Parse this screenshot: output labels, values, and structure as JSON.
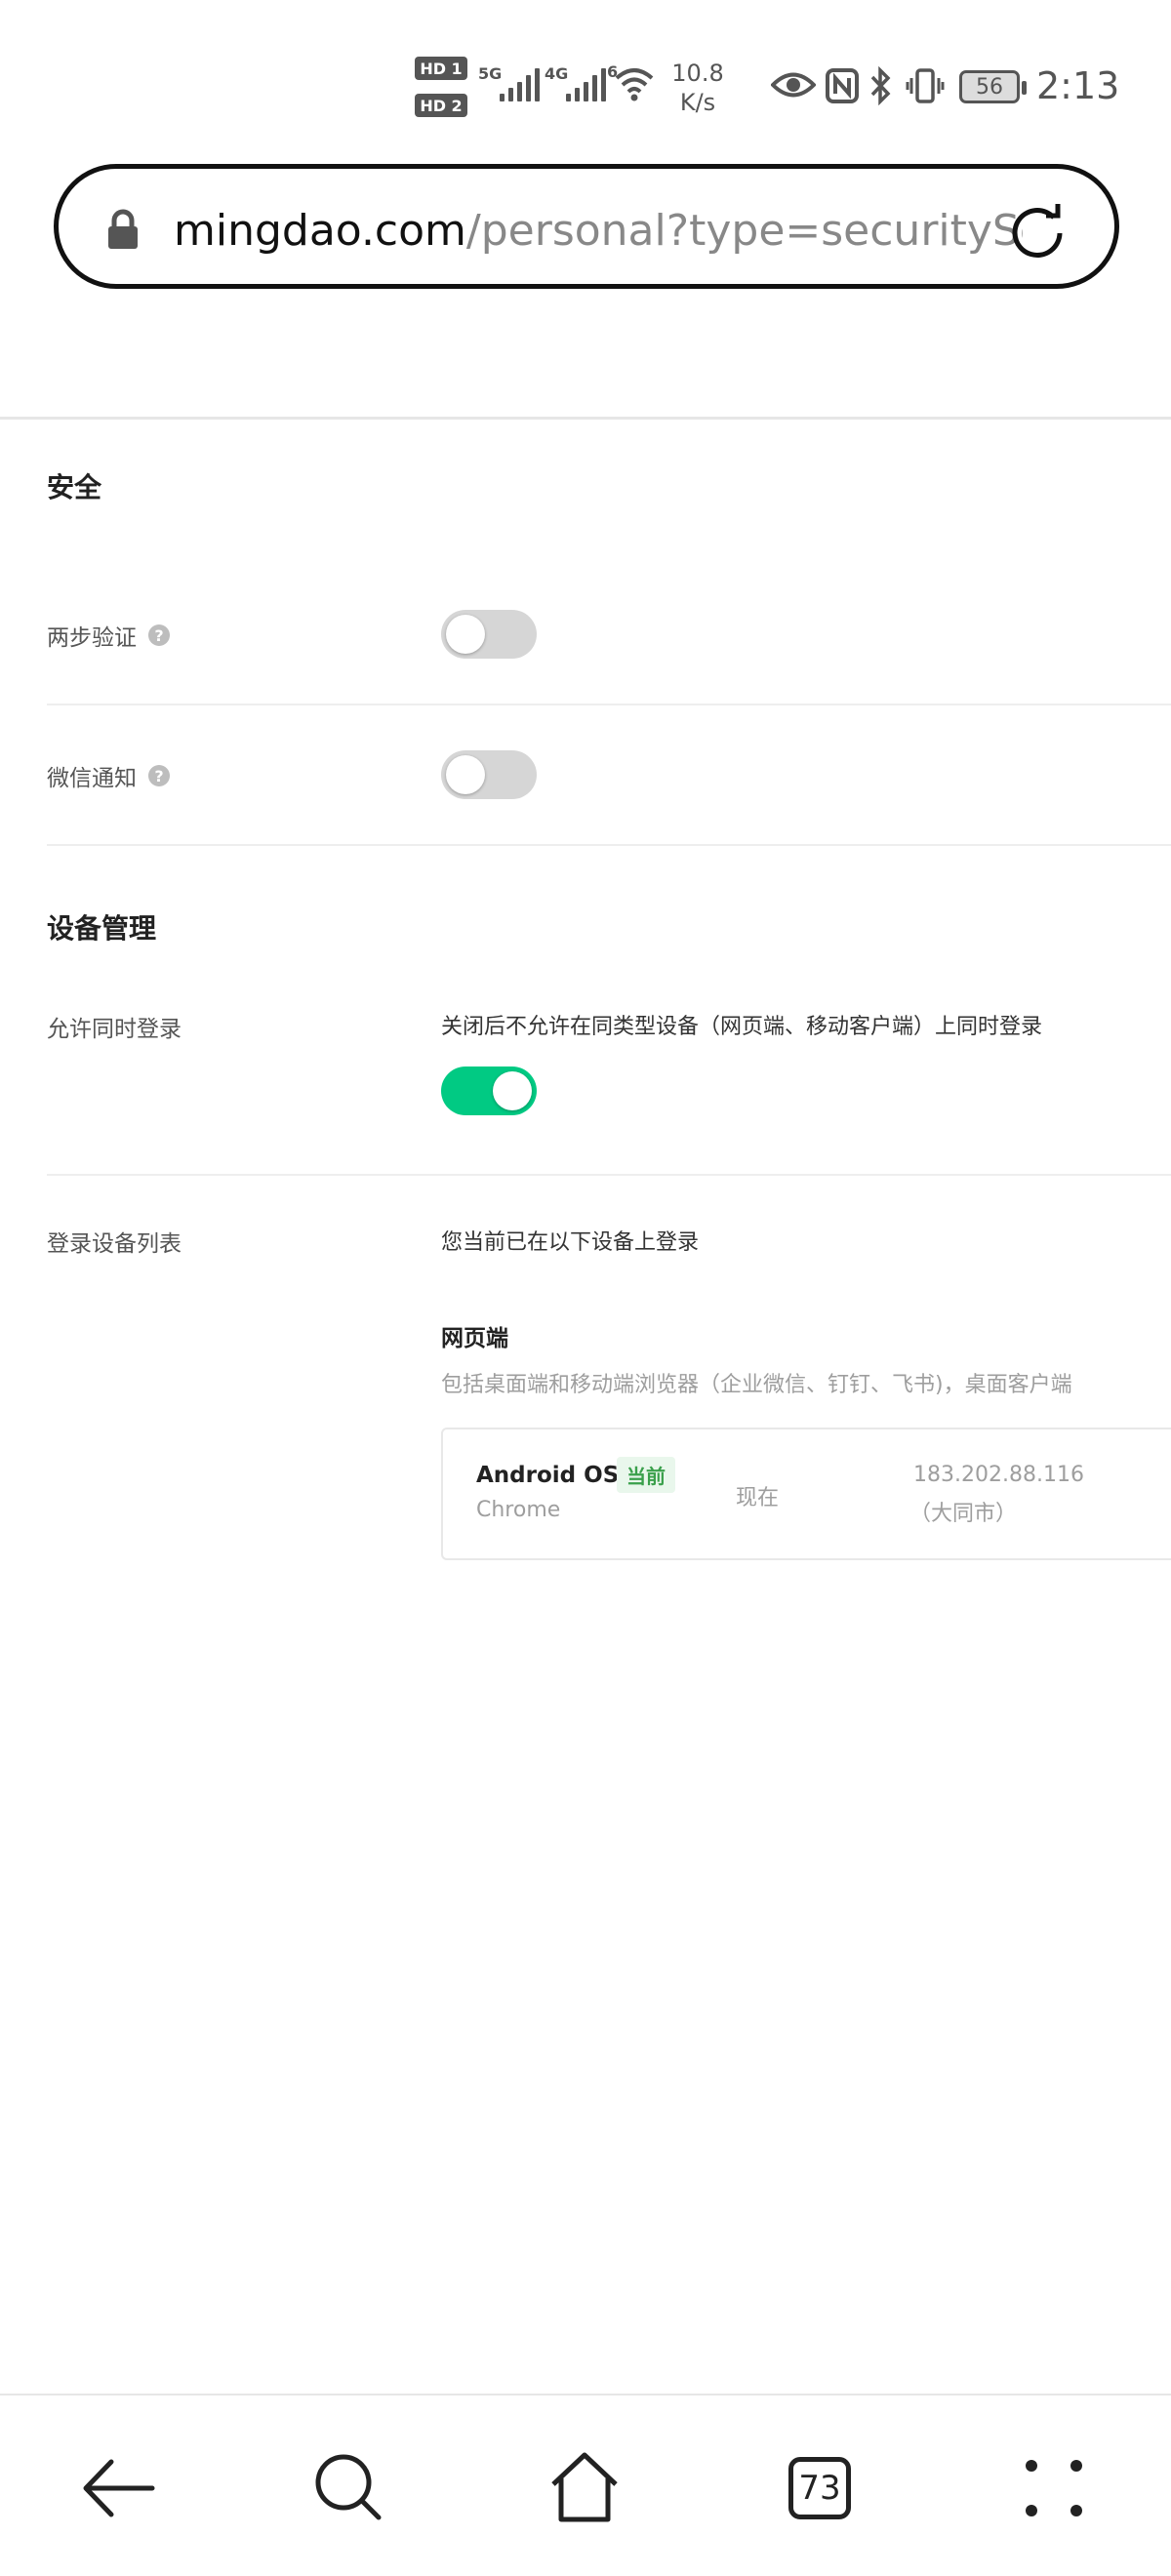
{
  "status_bar": {
    "hd1": "HD 1",
    "hd2": "HD 2",
    "sim1_network": "5G",
    "sim2_network": "4G",
    "wifi_label": "6",
    "net_speed_value": "10.8",
    "net_speed_unit": "K/s",
    "battery": "56",
    "time": "2:13",
    "icons": [
      "eye-icon",
      "nfc-icon",
      "bluetooth-icon",
      "vibrate-icon"
    ]
  },
  "browser": {
    "url_host": "mingdao.com",
    "url_path": "/personal?type=securitySe",
    "tab_count": "73"
  },
  "security": {
    "title": "安全",
    "two_step": {
      "label": "两步验证",
      "enabled": false
    },
    "wechat_notify": {
      "label": "微信通知",
      "enabled": false
    }
  },
  "device_management": {
    "title": "设备管理",
    "allow_simultaneous": {
      "label": "允许同时登录",
      "description": "关闭后不允许在同类型设备（网页端、移动客户端）上同时登录",
      "enabled": true
    },
    "device_list": {
      "label": "登录设备列表",
      "intro": "您当前已在以下设备上登录",
      "group_title": "网页端",
      "group_desc": "包括桌面端和移动端浏览器（企业微信、钉钉、飞书)，桌面客户端",
      "devices": [
        {
          "os": "Android OS",
          "badge": "当前",
          "browser": "Chrome",
          "time": "现在",
          "ip": "183.202.88.116",
          "location": "（大同市）"
        }
      ]
    }
  },
  "colors": {
    "toggle_on": "#01ca83",
    "toggle_off": "#d6d6d6",
    "badge_bg": "#e9f7ec",
    "badge_text": "#3aa04b"
  }
}
